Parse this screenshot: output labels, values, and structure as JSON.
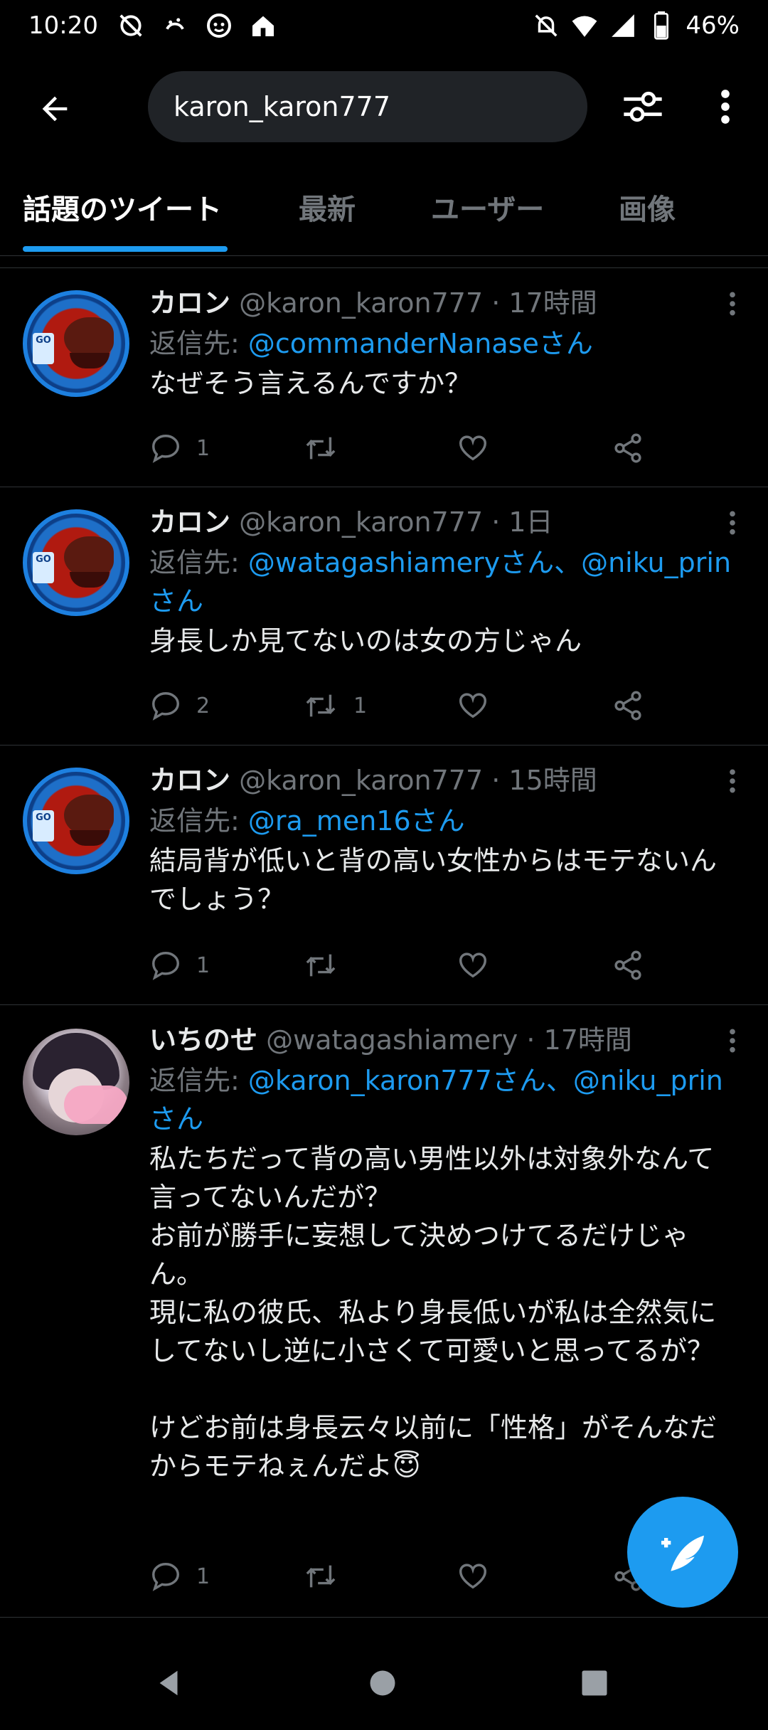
{
  "status_bar": {
    "time": "10:20",
    "battery": "46%",
    "left_icons": [
      "no-alarm-icon",
      "voicemail-icon",
      "kids-face-icon",
      "home-icon"
    ],
    "right_icons": [
      "mute-bell-icon",
      "wifi-icon",
      "signal-icon",
      "battery-icon"
    ]
  },
  "header": {
    "search_value": "karon_karon777"
  },
  "tabs": [
    {
      "label": "話題のツイート",
      "active": true
    },
    {
      "label": "最新",
      "active": false
    },
    {
      "label": "ユーザー",
      "active": false
    },
    {
      "label": "画像",
      "active": false
    }
  ],
  "tweets": [
    {
      "name": "カロン",
      "handle": "@karon_karon777",
      "time": "· 17時間",
      "reply_prefix": "返信先: ",
      "reply_to": "@commanderNanaseさん",
      "text": "なぜそう言えるんですか？",
      "replies": "1",
      "retweets": "",
      "likes": ""
    },
    {
      "name": "カロン",
      "handle": "@karon_karon777",
      "time": "· 1日",
      "reply_prefix": "返信先: ",
      "reply_to": "@watagashiameryさん、@niku_prinさん",
      "text": "身長しか見てないのは女の方じゃん",
      "replies": "2",
      "retweets": "1",
      "likes": ""
    },
    {
      "name": "カロン",
      "handle": "@karon_karon777",
      "time": "· 15時間",
      "reply_prefix": "返信先: ",
      "reply_to": "@ra_men16さん",
      "text": "結局背が低いと背の高い女性からはモテないんでしょう？",
      "replies": "1",
      "retweets": "",
      "likes": ""
    },
    {
      "name": "いちのせ",
      "handle": "@watagashiamery",
      "time": "· 17時間",
      "reply_prefix": "返信先: ",
      "reply_to": "@karon_karon777さん、@niku_prinさん",
      "text": "私たちだって背の高い男性以外は対象外なんて言ってないんだが？\nお前が勝手に妄想して決めつけてるだけじゃん。\n現に私の彼氏、私より身長低いが私は全然気にしてないし逆に小さくて可愛いと思ってるが？\n\nけどお前は身長云々以前に「性格」がそんなだからモテねぇんだよ😇",
      "replies": "1",
      "retweets": "",
      "likes": ""
    }
  ],
  "colors": {
    "accent": "#1d9bf0",
    "muted": "#71767b",
    "background": "#000000"
  }
}
